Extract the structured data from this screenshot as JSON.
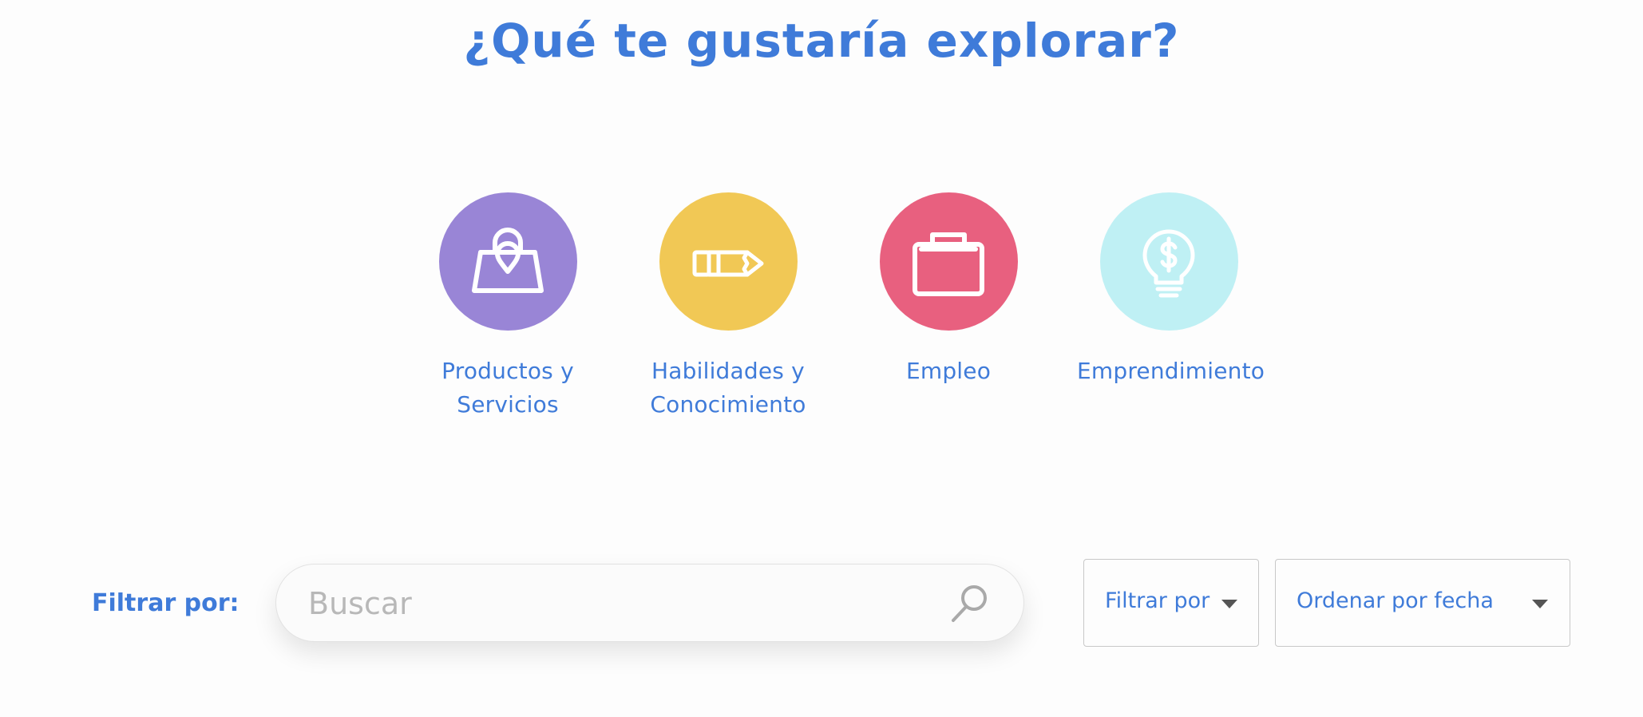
{
  "colors": {
    "accent": "#3f7bd9",
    "purple": "#9985d6",
    "yellow": "#f1c855",
    "pink": "#e8607f",
    "cyan": "#bff0f4"
  },
  "heading": "¿Qué te gustaría explorar?",
  "categories": [
    {
      "label": "Productos y Servicios",
      "icon": "shopping-bag-icon",
      "color": "#9985d6"
    },
    {
      "label": "Habilidades y Conocimiento",
      "icon": "pencil-icon",
      "color": "#f1c855"
    },
    {
      "label": "Empleo",
      "icon": "briefcase-icon",
      "color": "#e8607f"
    },
    {
      "label": "Emprendimiento",
      "icon": "lightbulb-dollar-icon",
      "color": "#bff0f4"
    }
  ],
  "filter_bar": {
    "label": "Filtrar por:",
    "search": {
      "placeholder": "Buscar",
      "value": "",
      "icon": "search-icon"
    },
    "filter_dropdown": {
      "selected": "Filtrar por"
    },
    "sort_dropdown": {
      "selected": "Ordenar por fecha"
    }
  }
}
